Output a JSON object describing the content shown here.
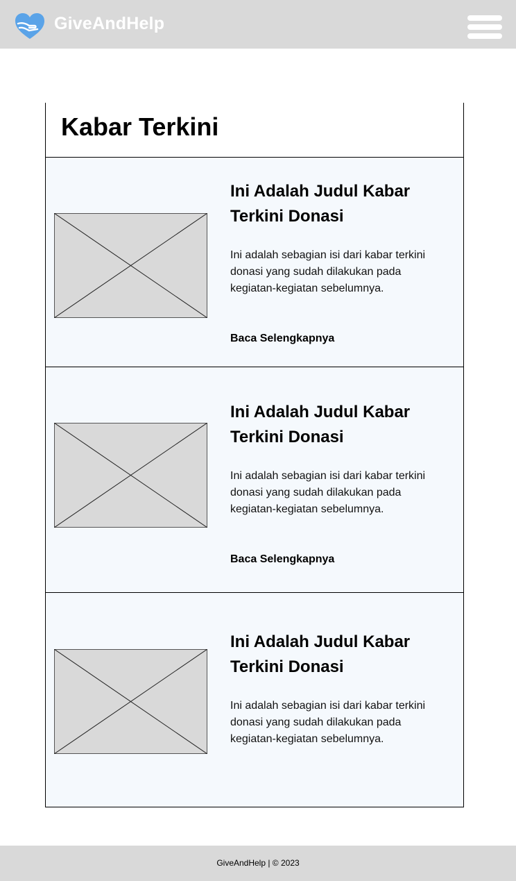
{
  "header": {
    "brand": "GiveAndHelp",
    "logo_icon": "heart-hand-icon",
    "menu_icon": "hamburger-menu-icon",
    "background": "#d9d9d9",
    "logo_color": "#5aa3e8"
  },
  "section": {
    "title": "Kabar Terkini"
  },
  "news": [
    {
      "title": "Ini Adalah Judul  Kabar Terkini Donasi",
      "excerpt": "Ini adalah sebagian isi dari kabar terkini donasi yang sudah dilakukan pada kegiatan-kegiatan sebelumnya.",
      "link": "Baca Selengkapnya"
    },
    {
      "title": "Ini Adalah Judul  Kabar Terkini Donasi",
      "excerpt": "Ini adalah sebagian isi dari kabar terkini donasi yang sudah dilakukan pada kegiatan-kegiatan sebelumnya.",
      "link": "Baca Selengkapnya"
    },
    {
      "title": "Ini Adalah Judul  Kabar Terkini Donasi",
      "excerpt": "Ini adalah sebagian isi dari kabar terkini donasi yang sudah dilakukan pada kegiatan-kegiatan sebelumnya."
    }
  ],
  "footer": {
    "text": "GiveAndHelp | © 2023"
  }
}
